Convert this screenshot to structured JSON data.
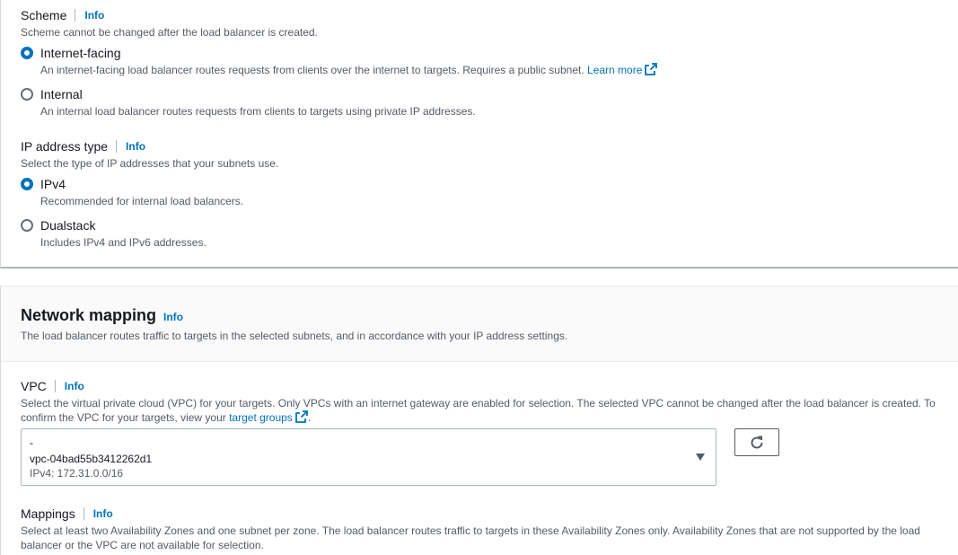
{
  "scheme": {
    "label": "Scheme",
    "info": "Info",
    "description": "Scheme cannot be changed after the load balancer is created.",
    "options": [
      {
        "label": "Internet-facing",
        "selected": true,
        "description": "An internet-facing load balancer routes requests from clients over the internet to targets. Requires a public subnet.",
        "link": "Learn more"
      },
      {
        "label": "Internal",
        "selected": false,
        "description": "An internal load balancer routes requests from clients to targets using private IP addresses."
      }
    ]
  },
  "ip_address_type": {
    "label": "IP address type",
    "info": "Info",
    "description": "Select the type of IP addresses that your subnets use.",
    "options": [
      {
        "label": "IPv4",
        "selected": true,
        "description": "Recommended for internal load balancers."
      },
      {
        "label": "Dualstack",
        "selected": false,
        "description": "Includes IPv4 and IPv6 addresses."
      }
    ]
  },
  "network_mapping": {
    "title": "Network mapping",
    "info": "Info",
    "description": "The load balancer routes traffic to targets in the selected subnets, and in accordance with your IP address settings.",
    "vpc": {
      "label": "VPC",
      "info": "Info",
      "description": "Select the virtual private cloud (VPC) for your targets. Only VPCs with an internet gateway are enabled for selection. The selected VPC cannot be changed after the load balancer is created. To confirm the VPC for your targets, view your",
      "link": "target groups",
      "suffix": ".",
      "selected_name": "-",
      "selected_id": "vpc-04bad55b3412262d1",
      "selected_cidr": "IPv4: 172.31.0.0/16"
    },
    "mappings": {
      "label": "Mappings",
      "info": "Info",
      "description": "Select at least two Availability Zones and one subnet per zone. The load balancer routes traffic to targets in these Availability Zones only. Availability Zones that are not supported by the load balancer or the VPC are not available for selection."
    }
  },
  "colors": {
    "accent": "#0073bb",
    "text": "#16191f",
    "secondary_text": "#545b64",
    "border": "#aab7b8"
  },
  "icons": [
    "external-link-icon",
    "refresh-icon",
    "caret-down-icon"
  ]
}
